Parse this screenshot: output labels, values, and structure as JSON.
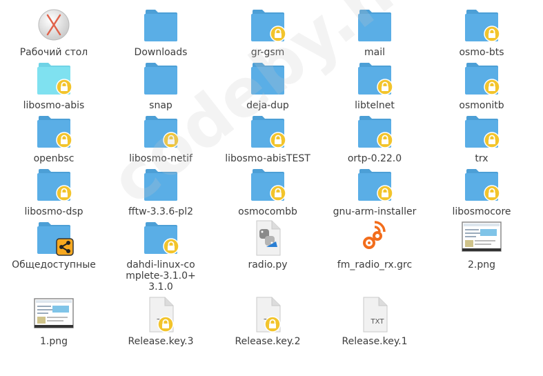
{
  "watermark": "codeby.net",
  "colors": {
    "folder": "#5aaee6",
    "folder_tab": "#4c9fd6",
    "folder_light": "#7fe1f0",
    "lock": "#f2c42c",
    "share": "#f7a81f",
    "grc": "#f26d1c",
    "label": "#3c3c3c"
  },
  "items": [
    {
      "name": "Рабочий стол",
      "icon": "desktop-icon"
    },
    {
      "name": "Downloads",
      "icon": "folder-icon"
    },
    {
      "name": "gr-gsm",
      "icon": "locked-folder-icon"
    },
    {
      "name": "mail",
      "icon": "folder-icon"
    },
    {
      "name": "osmo-bts",
      "icon": "locked-folder-icon"
    },
    {
      "name": "libosmo-abis",
      "icon": "locked-folder-light-icon"
    },
    {
      "name": "snap",
      "icon": "folder-icon"
    },
    {
      "name": "deja-dup",
      "icon": "folder-icon"
    },
    {
      "name": "libtelnet",
      "icon": "locked-folder-icon"
    },
    {
      "name": "osmonitb",
      "icon": "locked-folder-icon"
    },
    {
      "name": "openbsc",
      "icon": "locked-folder-icon"
    },
    {
      "name": "libosmo-netif",
      "icon": "locked-folder-icon"
    },
    {
      "name": "libosmo-abisTEST",
      "icon": "locked-folder-icon"
    },
    {
      "name": "ortp-0.22.0",
      "icon": "locked-folder-icon"
    },
    {
      "name": "trx",
      "icon": "locked-folder-icon"
    },
    {
      "name": "libosmo-dsp",
      "icon": "locked-folder-icon"
    },
    {
      "name": "fftw-3.3.6-pl2",
      "icon": "folder-icon"
    },
    {
      "name": "osmocombb",
      "icon": "locked-folder-icon"
    },
    {
      "name": "gnu-arm-installer",
      "icon": "locked-folder-icon"
    },
    {
      "name": "libosmocore",
      "icon": "locked-folder-icon"
    },
    {
      "name": "Общедоступные",
      "icon": "shared-folder-icon"
    },
    {
      "name": "dahdi-linux-complete-3.1.0+3.1.0",
      "icon": "locked-folder-icon"
    },
    {
      "name": "radio.py",
      "icon": "python-file-icon"
    },
    {
      "name": "fm_radio_rx.grc",
      "icon": "grc-file-icon"
    },
    {
      "name": "2.png",
      "icon": "image-thumbnail-icon"
    },
    {
      "name": "1.png",
      "icon": "image-thumbnail-icon"
    },
    {
      "name": "Release.key.3",
      "icon": "locked-text-file-icon"
    },
    {
      "name": "Release.key.2",
      "icon": "locked-text-file-icon"
    },
    {
      "name": "Release.key.1",
      "icon": "text-file-icon"
    }
  ],
  "text_file_badge": "TXT"
}
